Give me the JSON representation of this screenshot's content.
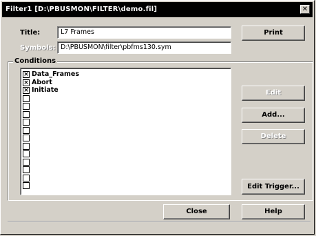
{
  "window": {
    "title": "Filter1 [D:\\PBUSMON\\FILTER\\demo.fil]",
    "close_glyph": "✕"
  },
  "form": {
    "title_label": "Title:",
    "title_value": "L7 Frames",
    "symbols_label": "Symbols:",
    "symbols_value": "D:\\PBUSMON\\filter\\pbfms130.sym"
  },
  "conditions": {
    "label": "Conditions",
    "items": [
      {
        "label": "Data_Frames",
        "checked": true
      },
      {
        "label": "Abort",
        "checked": true
      },
      {
        "label": "Initiate",
        "checked": true
      },
      {
        "label": "",
        "checked": false
      },
      {
        "label": "",
        "checked": false
      },
      {
        "label": "",
        "checked": false
      },
      {
        "label": "",
        "checked": false
      },
      {
        "label": "",
        "checked": false
      },
      {
        "label": "",
        "checked": false
      },
      {
        "label": "",
        "checked": false
      },
      {
        "label": "",
        "checked": false
      },
      {
        "label": "",
        "checked": false
      },
      {
        "label": "",
        "checked": false
      },
      {
        "label": "",
        "checked": false
      },
      {
        "label": "",
        "checked": false
      }
    ]
  },
  "buttons": {
    "print": "Print",
    "edit": "Edit",
    "add": "Add...",
    "delete": "Delete",
    "edit_trigger": "Edit Trigger...",
    "close": "Close",
    "help": "Help"
  },
  "colors": {
    "face": "#d4d0c8",
    "titlebar": "#000000",
    "title_text": "#ffffff"
  }
}
